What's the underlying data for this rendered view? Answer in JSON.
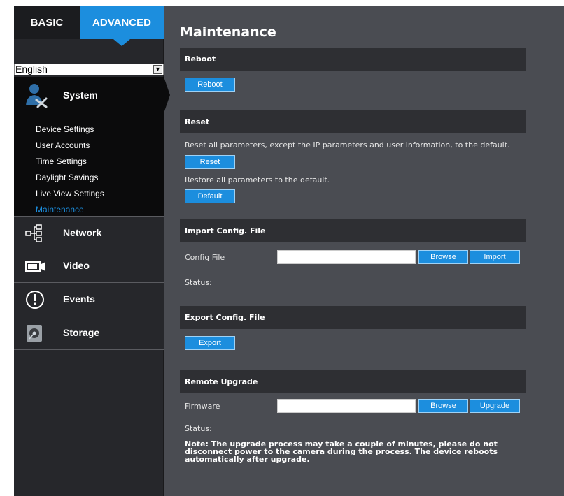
{
  "tabs": {
    "basic": "BASIC",
    "advanced": "ADVANCED"
  },
  "language": {
    "selected": "English"
  },
  "sidebar": {
    "system": {
      "label": "System",
      "items": [
        {
          "label": "Device Settings"
        },
        {
          "label": "User Accounts"
        },
        {
          "label": "Time Settings"
        },
        {
          "label": "Daylight Savings"
        },
        {
          "label": "Live View Settings"
        },
        {
          "label": "Maintenance"
        }
      ]
    },
    "categories": {
      "network": "Network",
      "video": "Video",
      "events": "Events",
      "storage": "Storage"
    }
  },
  "main": {
    "title": "Maintenance",
    "reboot": {
      "header": "Reboot",
      "button": "Reboot"
    },
    "reset": {
      "header": "Reset",
      "description": "Reset all parameters, except the IP parameters and user information, to the default.",
      "reset_button": "Reset",
      "restore_description": "Restore all parameters to the default.",
      "default_button": "Default"
    },
    "import": {
      "header": "Import Config. File",
      "field_label": "Config File",
      "field_value": "",
      "browse_button": "Browse",
      "import_button": "Import",
      "status_label": "Status:"
    },
    "export": {
      "header": "Export Config. File",
      "button": "Export"
    },
    "upgrade": {
      "header": "Remote Upgrade",
      "field_label": "Firmware",
      "field_value": "",
      "browse_button": "Browse",
      "upgrade_button": "Upgrade",
      "status_label": "Status:",
      "note_line1": "Note: The upgrade process may take a couple of minutes, please do not",
      "note_line2": "disconnect power to the camera during the process. The device reboots",
      "note_line3": "automatically after upgrade."
    }
  },
  "colors": {
    "accent": "#1c8ede",
    "content_bg": "#4a4c52",
    "sidebar_bg": "#26272b",
    "section_bar": "#2e2f33"
  }
}
